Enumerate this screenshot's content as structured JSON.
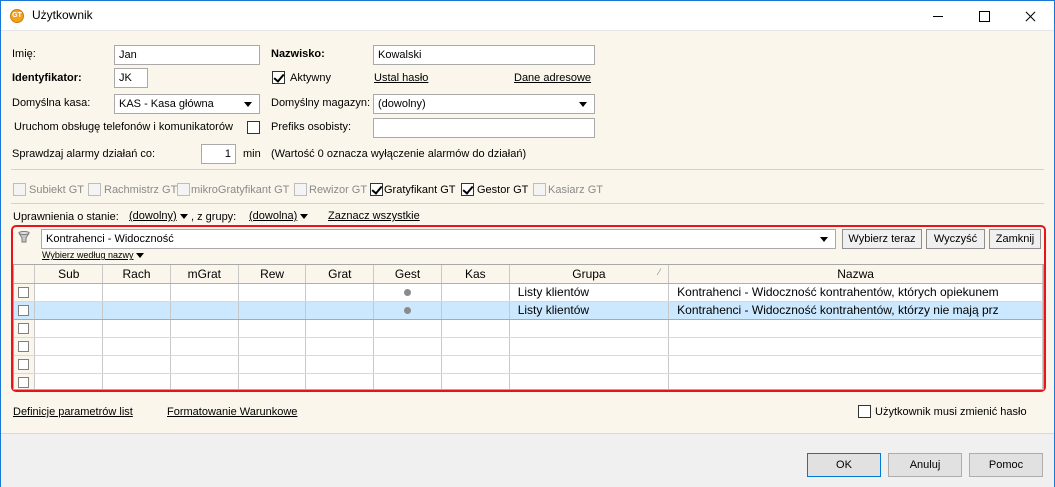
{
  "window": {
    "title": "Użytkownik",
    "icon": "app-gt-icon",
    "icon_text": "GT"
  },
  "form": {
    "imie_label": "Imię:",
    "imie_value": "Jan",
    "nazwisko_label": "Nazwisko:",
    "nazwisko_value": "Kowalski",
    "identyfikator_label": "Identyfikator:",
    "identyfikator_value": "JK",
    "aktywny_label": "Aktywny",
    "aktywny_checked": true,
    "ustal_haslo": "Ustal hasło",
    "dane_adresowe": "Dane adresowe",
    "kasa_label": "Domyślna kasa:",
    "kasa_value": "KAS - Kasa główna",
    "magazyn_label": "Domyślny magazyn:",
    "magazyn_value": "(dowolny)",
    "telefon_label": "Uruchom obsługę telefonów i komunikatorów",
    "prefiks_label": "Prefiks osobisty:",
    "prefiks_value": "",
    "alarm_label": "Sprawdzaj alarmy działań co:",
    "alarm_value": "1",
    "alarm_unit": "min",
    "alarm_note": "(Wartość 0 oznacza wyłączenie alarmów do działań)"
  },
  "modules": [
    {
      "label": "Subiekt GT",
      "checked": false,
      "enabled": false
    },
    {
      "label": "Rachmistrz GT",
      "checked": false,
      "enabled": false
    },
    {
      "label": "mikroGratyfikant GT",
      "checked": false,
      "enabled": false
    },
    {
      "label": "Rewizor GT",
      "checked": false,
      "enabled": false
    },
    {
      "label": "Gratyfikant GT",
      "checked": true,
      "enabled": true
    },
    {
      "label": "Gestor GT",
      "checked": true,
      "enabled": true
    },
    {
      "label": "Kasiarz GT",
      "checked": false,
      "enabled": false
    }
  ],
  "permissions": {
    "stan_label": "Uprawnienia o stanie:",
    "stan_value": "(dowolny)",
    "grupa_label": ", z grupy:",
    "grupa_value": "(dowolna)",
    "select_all": "Zaznacz wszystkie"
  },
  "filter": {
    "value": "Kontrahenci - Widoczność",
    "by_name": "Wybierz według nazwy",
    "btn_choose": "Wybierz teraz",
    "btn_clear": "Wyczyść",
    "btn_close": "Zamknij"
  },
  "grid": {
    "columns": [
      "Sub",
      "Rach",
      "mGrat",
      "Rew",
      "Grat",
      "Gest",
      "Kas",
      "Grupa",
      "Nazwa"
    ],
    "rows": [
      {
        "gest": true,
        "grupa": "Listy klientów",
        "nazwa": "Kontrahenci - Widoczność kontrahentów, których opiekunem",
        "selected": false
      },
      {
        "gest": true,
        "grupa": "Listy klientów",
        "nazwa": "Kontrahenci - Widoczność kontrahentów, którzy nie mają prz",
        "selected": true
      }
    ],
    "empty_rows": 4
  },
  "footer": {
    "definicje": "Definicje parametrów list",
    "formatowanie": "Formatowanie Warunkowe",
    "must_change_label": "Użytkownik musi zmienić hasło",
    "must_change_checked": false
  },
  "buttons": {
    "ok": "OK",
    "cancel": "Anuluj",
    "help": "Pomoc"
  }
}
